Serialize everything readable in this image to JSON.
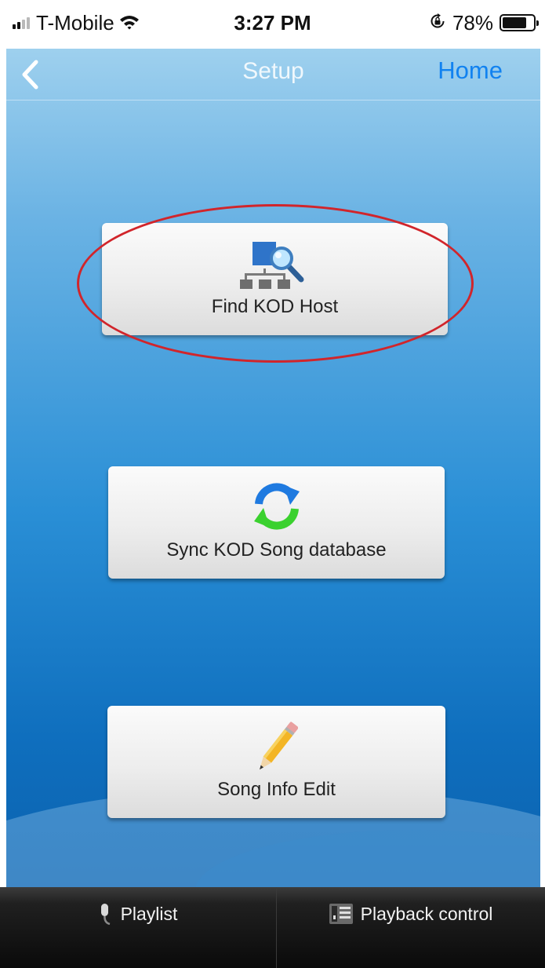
{
  "status_bar": {
    "carrier": "T-Mobile",
    "time": "3:27 PM",
    "battery_percent": "78%",
    "battery_level": 0.78,
    "signal_bars_filled": 2,
    "signal_bars_total": 4
  },
  "nav": {
    "title": "Setup",
    "home_label": "Home"
  },
  "buttons": {
    "find_host": {
      "label": "Find KOD Host",
      "icon": "network-search-icon"
    },
    "sync_db": {
      "label": "Sync KOD Song database",
      "icon": "sync-icon"
    },
    "song_edit": {
      "label": "Song Info Edit",
      "icon": "pencil-icon"
    }
  },
  "annotation": {
    "color": "#d1252b"
  },
  "tabs": {
    "playlist": {
      "label": "Playlist",
      "icon": "microphone-icon"
    },
    "playback": {
      "label": "Playback control",
      "icon": "playback-control-icon"
    }
  },
  "colors": {
    "home_link": "#1182f0",
    "background_top": "#9ed0ee",
    "background_bottom": "#0b62af"
  }
}
